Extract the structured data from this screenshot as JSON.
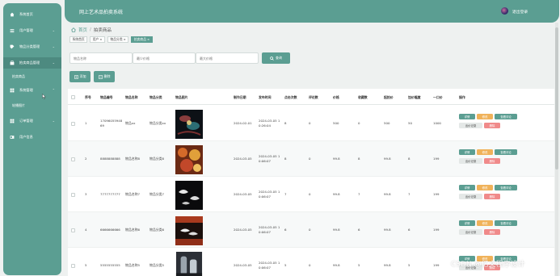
{
  "app": {
    "title": "网上艺术品拍卖系统",
    "logout": "退出登录"
  },
  "sidebar": {
    "items": [
      {
        "label": "系统首页",
        "icon": "home-icon",
        "chevron": ""
      },
      {
        "label": "用户管理",
        "icon": "user-icon",
        "chevron": "⌄"
      },
      {
        "label": "物品分类管理",
        "icon": "category-icon",
        "chevron": "⌄"
      },
      {
        "label": "拍卖商品管理",
        "icon": "goods-icon",
        "chevron": "⌄"
      },
      {
        "label": "系统管理",
        "icon": "grid-icon",
        "chevron": "⌃"
      },
      {
        "label": "订单管理",
        "icon": "order-icon",
        "chevron": "⌄"
      },
      {
        "label": "用户信息",
        "icon": "profile-icon",
        "chevron": ""
      }
    ],
    "sub_goods": "拍卖商品",
    "sub_system": "轮播图片"
  },
  "breadcrumb": {
    "home": "首页",
    "sep": "/",
    "current": "拍卖商品"
  },
  "tags": [
    {
      "label": "系统首页",
      "close": ""
    },
    {
      "label": "用户",
      "close": "×"
    },
    {
      "label": "物品分类",
      "close": "×"
    },
    {
      "label": "拍卖商品",
      "close": "×"
    }
  ],
  "filters": {
    "p1": "物品名称",
    "p2": "最少价格",
    "p3": "最大价格",
    "search": "查询"
  },
  "actions": {
    "add": "添加",
    "delete": "删除"
  },
  "table": {
    "headers": [
      "序号",
      "物品编号",
      "物品名称",
      "物品分类",
      "物品图片",
      "制作日期",
      "发布时间",
      "点击次数",
      "评论数",
      "价格",
      "收藏数",
      "起拍价",
      "加价幅度",
      "一口价",
      "操作"
    ],
    "rows": [
      {
        "idx": "1",
        "code1": "17096055948",
        "code2": "69",
        "name": "物品xx",
        "cat": "物品分类xx",
        "date": "2024-02-01",
        "pub1": "2024-03-05 1",
        "pub2": "0:26:04",
        "clicks": "8",
        "comments": "0",
        "price": "500",
        "fav": "0",
        "start": "500",
        "step": "50",
        "buyout": "1000"
      },
      {
        "idx": "2",
        "code1": "8888888888",
        "code2": "",
        "name": "物品名称8",
        "cat": "物品分类8",
        "date": "2024-03-05",
        "pub1": "2024-03-05 1",
        "pub2": "0:06:07",
        "clicks": "8",
        "comments": "0",
        "price": "99.8",
        "fav": "8",
        "start": "99.8",
        "step": "8",
        "buyout": "199"
      },
      {
        "idx": "3",
        "code1": "7777777777",
        "code2": "",
        "name": "物品名称7",
        "cat": "物品分类7",
        "date": "2024-03-05",
        "pub1": "2024-03-05 1",
        "pub2": "0:06:07",
        "clicks": "7",
        "comments": "0",
        "price": "99.8",
        "fav": "7",
        "start": "99.8",
        "step": "7",
        "buyout": "199"
      },
      {
        "idx": "4",
        "code1": "6666666666",
        "code2": "",
        "name": "物品名称6",
        "cat": "物品分类6",
        "date": "2024-03-05",
        "pub1": "2024-03-05 1",
        "pub2": "0:06:07",
        "clicks": "6",
        "comments": "0",
        "price": "99.8",
        "fav": "6",
        "start": "99.8",
        "step": "6",
        "buyout": "199"
      },
      {
        "idx": "5",
        "code1": "5555555555",
        "code2": "",
        "name": "物品名称5",
        "cat": "物品分类5",
        "date": "2024-03-05",
        "pub1": "2024-03-05 1",
        "pub2": "0:06:07",
        "clicks": "5",
        "comments": "0",
        "price": "99.8",
        "fav": "5",
        "start": "99.8",
        "step": "5",
        "buyout": "199"
      }
    ],
    "btn_detail": "详情",
    "btn_edit": "修改",
    "btn_review": "查看评论",
    "btn_bids": "出价记录",
    "btn_delete": "删除"
  },
  "watermark": "CSDN @亿文程序设计",
  "colors": {
    "primary": "#5b9e92",
    "orange": "#f0b25a",
    "red": "#f08a8a"
  }
}
